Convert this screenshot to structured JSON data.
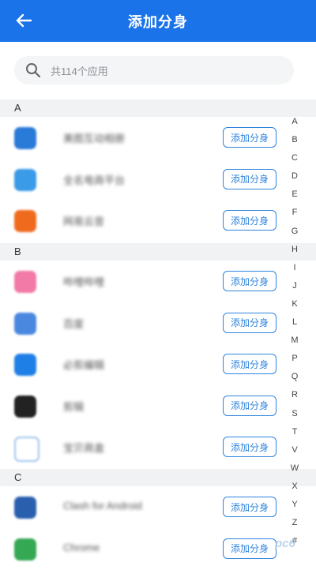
{
  "header": {
    "title": "添加分身"
  },
  "search": {
    "placeholder": "共114个应用"
  },
  "add_label": "添加分身",
  "sections": [
    {
      "letter": "A",
      "apps": [
        {
          "name": "美图互动相册",
          "icon_color": "#2a7ad8"
        },
        {
          "name": "全名电商平台",
          "icon_color": "#3a9be8"
        },
        {
          "name": "网易云音",
          "icon_color": "#f06a1e"
        }
      ]
    },
    {
      "letter": "B",
      "apps": [
        {
          "name": "哔哩哔哩",
          "icon_color": "#f27aa6"
        },
        {
          "name": "百度",
          "icon_color": "#4a88e0"
        },
        {
          "name": "必剪编辑",
          "icon_color": "#1e7fe6"
        },
        {
          "name": "剪辑",
          "icon_color": "#222222"
        },
        {
          "name": "宝贝商盒",
          "icon_color": "#ffffff"
        }
      ]
    },
    {
      "letter": "C",
      "apps": [
        {
          "name": "Clash for Android",
          "icon_color": "#2a5fae"
        },
        {
          "name": "Chrome",
          "icon_color": "#34a853"
        }
      ]
    }
  ],
  "index_letters": [
    "A",
    "B",
    "C",
    "D",
    "E",
    "F",
    "G",
    "H",
    "I",
    "J",
    "K",
    "L",
    "M",
    "P",
    "Q",
    "R",
    "S",
    "T",
    "V",
    "W",
    "X",
    "Y",
    "Z",
    "#"
  ],
  "watermark": "pc6"
}
